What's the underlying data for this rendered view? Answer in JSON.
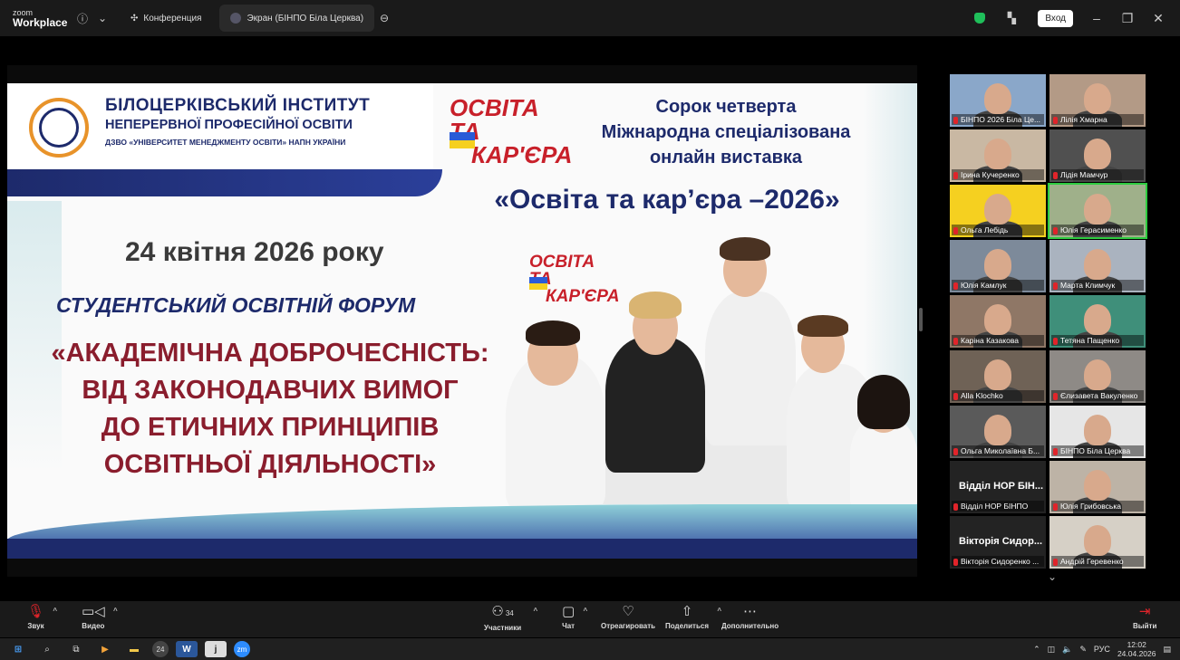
{
  "titlebar": {
    "logo_top": "zoom",
    "logo_bottom": "Workplace",
    "tab_conference": "Конференция",
    "tab_screen": "Экран (БІНПО Біла Церква)",
    "signin": "Вход"
  },
  "slide": {
    "institute_line1": "БІЛОЦЕРКІВСЬКИЙ ІНСТИТУТ",
    "institute_line2": "НЕПЕРЕРВНОЇ ПРОФЕСІЙНОЇ ОСВІТИ",
    "institute_line3": "ДЗВО «УНІВЕРСИТЕТ МЕНЕДЖМЕНТУ ОСВІТИ» НАПН УКРАЇНИ",
    "brand_line1": "ОСВІТА ТА",
    "brand_line2": "КАР'ЄРА",
    "event_line1": "Сорок четверта",
    "event_line2": "Міжнародна спеціалізована",
    "event_line3": "онлайн виставка",
    "event_name": "«Освіта та кар’єра –2026»",
    "date": "24 квітня 2026 року",
    "forum": "СТУДЕНТСЬКИЙ ОСВІТНІЙ ФОРУМ",
    "topic_line1": "«АКАДЕМІЧНА ДОБРОЧЕСНІСТЬ:",
    "topic_line2": "ВІД ЗАКОНОДАВЧИХ ВИМОГ",
    "topic_line3": "ДО ЕТИЧНИХ ПРИНЦИПІВ",
    "topic_line4": "ОСВІТНЬОЇ ДІЯЛЬНОСТІ»"
  },
  "gallery": {
    "tiles": [
      {
        "name": "БІНПО 2026 Біла Це..."
      },
      {
        "name": "Лілія Хмарна"
      },
      {
        "name": "Ірина Кучеренко"
      },
      {
        "name": "Лідія Мамчур"
      },
      {
        "name": "Ольга Лебідь"
      },
      {
        "name": "Юлія Герасименко"
      },
      {
        "name": "Юлія Камлук"
      },
      {
        "name": "Марта Климчук"
      },
      {
        "name": "Каріна Казакова"
      },
      {
        "name": "Тетяна Пащенко"
      },
      {
        "name": "Alla Klochko"
      },
      {
        "name": "Єлизавета Вакуленко"
      },
      {
        "name": "Ольга Миколаївна Б..."
      },
      {
        "name": "БІНПО Біла Церква"
      },
      {
        "name": "Відділ НОР БІНПО",
        "big": "Відділ НОР БІН..."
      },
      {
        "name": "Юлія Грибовська"
      },
      {
        "name": "Вікторія Сидоренко ...",
        "big": "Вікторія Сидор..."
      },
      {
        "name": "Андрій Геревенко"
      }
    ]
  },
  "toolbar": {
    "audio": "Звук",
    "video": "Видео",
    "participants": "Участники",
    "participants_count": "34",
    "chat": "Чат",
    "react": "Отреагировать",
    "share": "Поделиться",
    "more": "Дополнительно",
    "leave": "Выйти"
  },
  "taskbar": {
    "badge": "24",
    "lang": "РУС",
    "time": "12:02",
    "date": "24.04.2026"
  },
  "colors": {
    "navy": "#1d2a6b",
    "burgundy": "#8a1d2d",
    "brand_red": "#c8202a",
    "mic_muted": "#e0242a",
    "active_speaker": "#2ecc40"
  }
}
